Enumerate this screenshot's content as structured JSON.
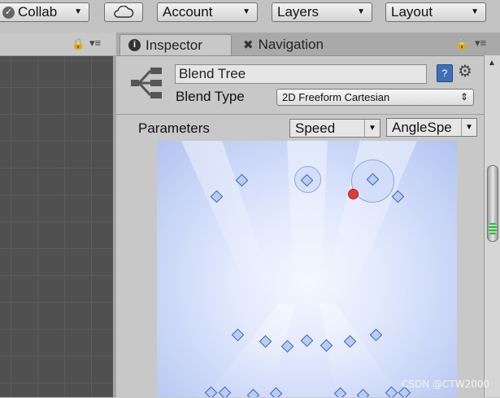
{
  "toolbar": {
    "collab_label": "Collab",
    "account_label": "Account",
    "layers_label": "Layers",
    "layout_label": "Layout"
  },
  "tabs": {
    "inspector": "Inspector",
    "navigation": "Navigation"
  },
  "blend_tree": {
    "name": "Blend Tree",
    "blend_type_label": "Blend Type",
    "blend_type_value": "2D Freeform Cartesian"
  },
  "parameters": {
    "label": "Parameters",
    "param_x": "Speed",
    "param_y": "AngleSpe"
  },
  "watermark": "CSDN @CTW2000",
  "colors": {
    "node_fill": "#b8cdf5",
    "node_border": "#3d63b3",
    "current_point": "#e03a3a",
    "graph_bg": "#c9d6f7"
  }
}
